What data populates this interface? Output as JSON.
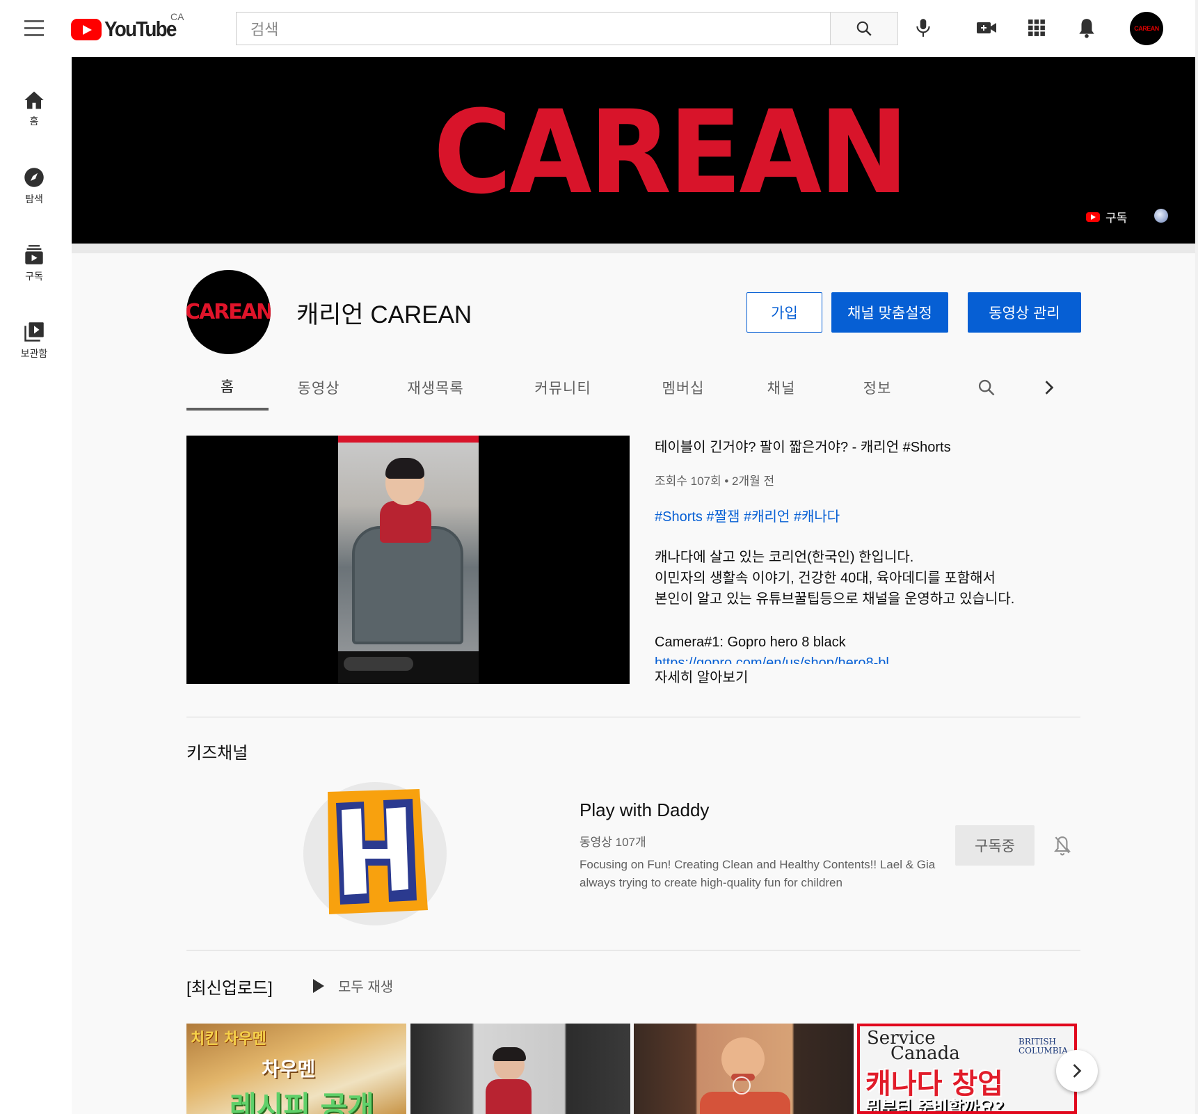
{
  "topbar": {
    "logo_text": "YouTube",
    "country": "CA",
    "search_placeholder": "검색"
  },
  "sidebar": {
    "items": [
      {
        "label": "홈",
        "icon": "home-icon"
      },
      {
        "label": "탐색",
        "icon": "explore-icon"
      },
      {
        "label": "구독",
        "icon": "subscriptions-icon"
      },
      {
        "label": "보관함",
        "icon": "library-icon"
      }
    ]
  },
  "banner": {
    "title": "CAREAN",
    "subscribe_label": "구독"
  },
  "channel": {
    "avatar_text": "CAREAN",
    "name": "캐리언 CAREAN",
    "join_label": "가입",
    "customize_label": "채널 맞춤설정",
    "manage_label": "동영상 관리",
    "tabs": [
      "홈",
      "동영상",
      "재생목록",
      "커뮤니티",
      "멤버십",
      "채널",
      "정보"
    ]
  },
  "featured_video": {
    "title": "테이블이 긴거야? 팔이 짧은거야? - 캐리언 #Shorts",
    "meta": "조회수 107회 • 2개월 전",
    "tags": "#Shorts #짤잼 #캐리언 #캐나다",
    "description": [
      "캐나다에 살고 있는 코리언(한국인) 한입니다.",
      "이민자의 생활속 이야기, 건강한 40대, 육아데디를 포함해서",
      "본인이 알고 있는 유튜브꿀팁등으로  채널을 운영하고 있습니다."
    ],
    "camera": "Camera#1: Gopro hero 8 black",
    "link": "https://gopro.com/en/us/shop/hero8-bl",
    "more": "자세히 알아보기"
  },
  "kids_section": {
    "title": "키즈채널",
    "channel_name": "Play with Daddy",
    "video_count": "동영상 107개",
    "description": "Focusing on Fun! Creating Clean and Healthy Contents!! Lael & Gia always trying to create high-quality fun for children",
    "subscribed_label": "구독중"
  },
  "latest_section": {
    "title": "[최신업로드]",
    "play_all": "모두 재생",
    "thumbnails": [
      {
        "text_top": "치킨 차우멘",
        "text_mid": "차우멘",
        "text_bottom": "레시피 공개"
      },
      {},
      {},
      {
        "text_top": "Service",
        "text_top2": "Canada",
        "badge": "BRITISH COLUMBIA",
        "text_mid": "캐나다 창업",
        "text_bottom": "뭐부터 준비할까요?"
      }
    ]
  },
  "colors": {
    "brand_red": "#ff0000",
    "link_blue": "#065fd4",
    "banner_red": "#d8142a"
  }
}
